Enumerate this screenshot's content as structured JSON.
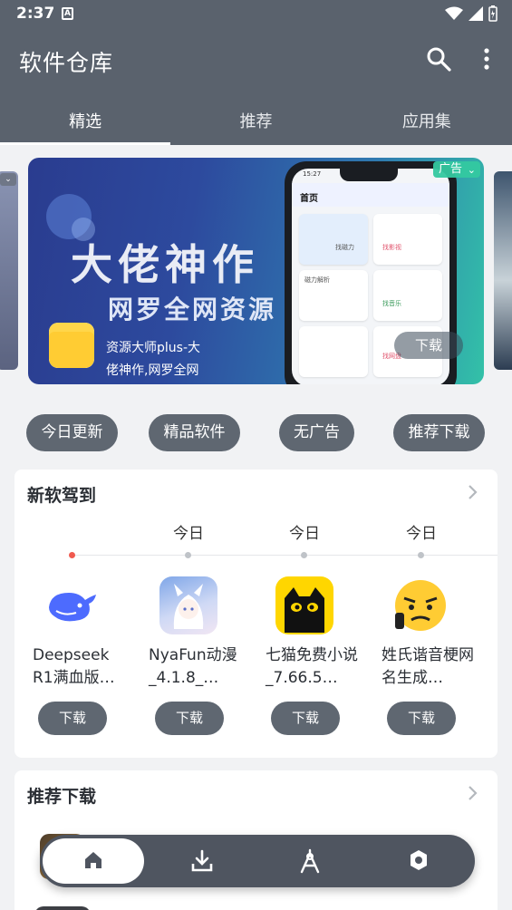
{
  "status_bar": {
    "time": "2:37",
    "notification_icon": "A"
  },
  "app_bar": {
    "title": "软件仓库",
    "actions": [
      "search-icon",
      "more-vert-icon"
    ]
  },
  "tabs": [
    {
      "label": "精选",
      "active": true
    },
    {
      "label": "推荐",
      "active": false
    },
    {
      "label": "应用集",
      "active": false
    }
  ],
  "banner": {
    "headline": "大佬神作",
    "subline": "网罗全网资源",
    "ad_label": "广告",
    "app_name": "资源大师plus-大佬神作,网罗全网资源",
    "download_label": "下载",
    "phone": {
      "time": "15:27",
      "home": "首页",
      "cards": [
        "找磁力",
        "找影视",
        "磁力解析",
        "找音乐",
        "找网盘"
      ]
    }
  },
  "chips": [
    "今日更新",
    "精品软件",
    "无广告",
    "推荐下载"
  ],
  "new_apps": {
    "title": "新软驾到",
    "day_labels": [
      "今日",
      "今日",
      "今日"
    ],
    "apps": [
      {
        "name": "Deepseek R1满血版…",
        "download": "下载",
        "icon": "deepseek-whale-icon"
      },
      {
        "name": "NyaFun动漫_4.1.8_…",
        "download": "下载",
        "icon": "anime-girl-icon"
      },
      {
        "name": "七猫免费小说_7.66.5…",
        "download": "下载",
        "icon": "black-cat-icon"
      },
      {
        "name": "姓氏谐音梗网名生成…",
        "download": "下载",
        "icon": "face-emoji-icon"
      }
    ]
  },
  "recommend": {
    "title": "推荐下载"
  },
  "bottom_nav": [
    "home-icon",
    "download-icon",
    "compass-icon",
    "settings-icon"
  ],
  "colors": {
    "primary": "#5a626d",
    "accent_dot": "#f05a4f",
    "pill": "#5f6771"
  }
}
